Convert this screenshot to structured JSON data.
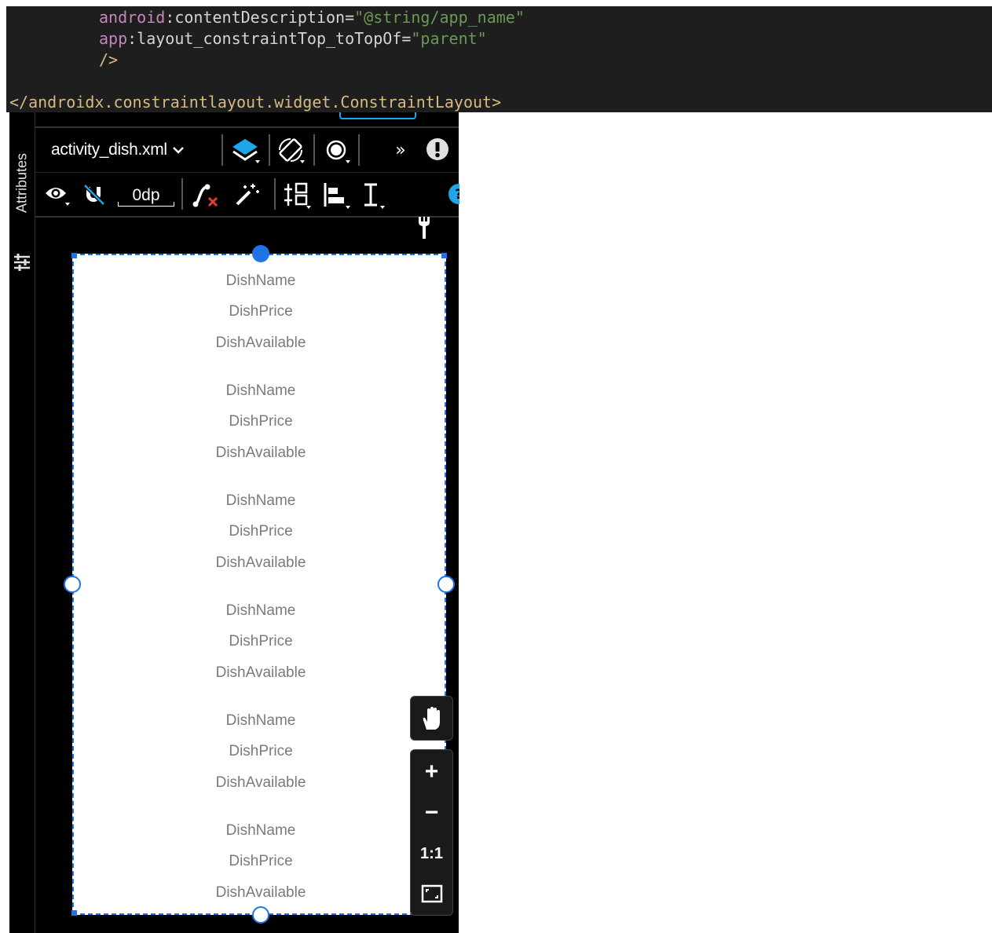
{
  "code_editor": {
    "line1": {
      "attr_ns": "android",
      "attr_name": ":contentDescription",
      "equals": "=",
      "value": "\"@string/app_name\""
    },
    "line2": {
      "attr_ns": "app",
      "attr_name": ":layout_constraintTop_toTopOf",
      "equals": "=",
      "value": "\"parent\""
    },
    "line3": {
      "self_close": "/>"
    },
    "line4": {
      "close_tag": "</androidx.constraintlayout.widget.ConstraintLayout>"
    }
  },
  "sidebar": {
    "attributes_label": "Attributes"
  },
  "toolbar": {
    "file_name": "activity_dish.xml",
    "default_margin": "0dp",
    "overflow_label": "»"
  },
  "canvas": {
    "groups": [
      {
        "name": "DishName",
        "price": "DishPrice",
        "available": "DishAvailable"
      },
      {
        "name": "DishName",
        "price": "DishPrice",
        "available": "DishAvailable"
      },
      {
        "name": "DishName",
        "price": "DishPrice",
        "available": "DishAvailable"
      },
      {
        "name": "DishName",
        "price": "DishPrice",
        "available": "DishAvailable"
      },
      {
        "name": "DishName",
        "price": "DishPrice",
        "available": "DishAvailable"
      },
      {
        "name": "DishName",
        "price": "DishPrice",
        "available": "DishAvailable"
      }
    ]
  },
  "zoom_controls": {
    "zoom_in": "+",
    "zoom_out": "−",
    "actual_size": "1:1"
  },
  "colors": {
    "selection_blue": "#1e73e8",
    "editor_background": "#1e1e1e",
    "panel_background": "#000000",
    "placeholder_text": "#7a7a7a",
    "help_icon": "#1ea7e8"
  }
}
